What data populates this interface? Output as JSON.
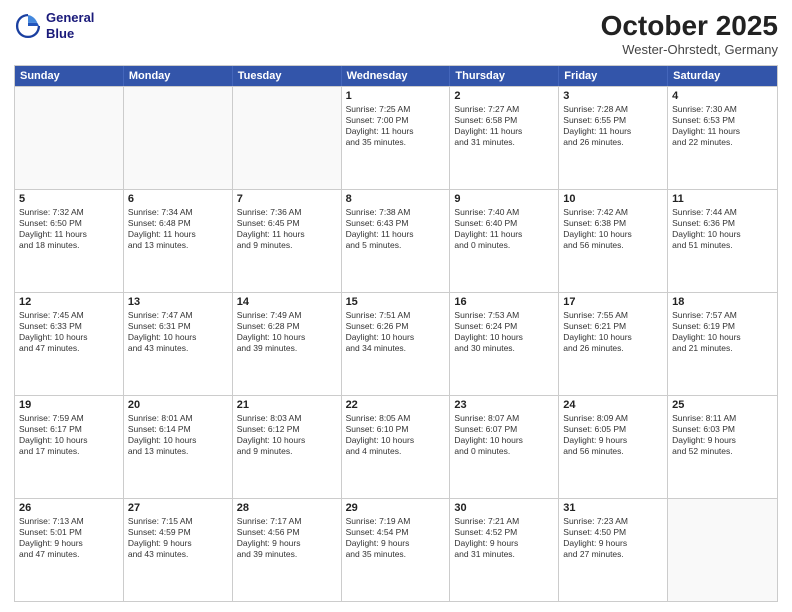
{
  "header": {
    "logo_line1": "General",
    "logo_line2": "Blue",
    "month": "October 2025",
    "location": "Wester-Ohrstedt, Germany"
  },
  "days_of_week": [
    "Sunday",
    "Monday",
    "Tuesday",
    "Wednesday",
    "Thursday",
    "Friday",
    "Saturday"
  ],
  "rows": [
    [
      {
        "num": "",
        "lines": [],
        "empty": true
      },
      {
        "num": "",
        "lines": [],
        "empty": true
      },
      {
        "num": "",
        "lines": [],
        "empty": true
      },
      {
        "num": "1",
        "lines": [
          "Sunrise: 7:25 AM",
          "Sunset: 7:00 PM",
          "Daylight: 11 hours",
          "and 35 minutes."
        ]
      },
      {
        "num": "2",
        "lines": [
          "Sunrise: 7:27 AM",
          "Sunset: 6:58 PM",
          "Daylight: 11 hours",
          "and 31 minutes."
        ]
      },
      {
        "num": "3",
        "lines": [
          "Sunrise: 7:28 AM",
          "Sunset: 6:55 PM",
          "Daylight: 11 hours",
          "and 26 minutes."
        ]
      },
      {
        "num": "4",
        "lines": [
          "Sunrise: 7:30 AM",
          "Sunset: 6:53 PM",
          "Daylight: 11 hours",
          "and 22 minutes."
        ]
      }
    ],
    [
      {
        "num": "5",
        "lines": [
          "Sunrise: 7:32 AM",
          "Sunset: 6:50 PM",
          "Daylight: 11 hours",
          "and 18 minutes."
        ]
      },
      {
        "num": "6",
        "lines": [
          "Sunrise: 7:34 AM",
          "Sunset: 6:48 PM",
          "Daylight: 11 hours",
          "and 13 minutes."
        ]
      },
      {
        "num": "7",
        "lines": [
          "Sunrise: 7:36 AM",
          "Sunset: 6:45 PM",
          "Daylight: 11 hours",
          "and 9 minutes."
        ]
      },
      {
        "num": "8",
        "lines": [
          "Sunrise: 7:38 AM",
          "Sunset: 6:43 PM",
          "Daylight: 11 hours",
          "and 5 minutes."
        ]
      },
      {
        "num": "9",
        "lines": [
          "Sunrise: 7:40 AM",
          "Sunset: 6:40 PM",
          "Daylight: 11 hours",
          "and 0 minutes."
        ]
      },
      {
        "num": "10",
        "lines": [
          "Sunrise: 7:42 AM",
          "Sunset: 6:38 PM",
          "Daylight: 10 hours",
          "and 56 minutes."
        ]
      },
      {
        "num": "11",
        "lines": [
          "Sunrise: 7:44 AM",
          "Sunset: 6:36 PM",
          "Daylight: 10 hours",
          "and 51 minutes."
        ]
      }
    ],
    [
      {
        "num": "12",
        "lines": [
          "Sunrise: 7:45 AM",
          "Sunset: 6:33 PM",
          "Daylight: 10 hours",
          "and 47 minutes."
        ]
      },
      {
        "num": "13",
        "lines": [
          "Sunrise: 7:47 AM",
          "Sunset: 6:31 PM",
          "Daylight: 10 hours",
          "and 43 minutes."
        ]
      },
      {
        "num": "14",
        "lines": [
          "Sunrise: 7:49 AM",
          "Sunset: 6:28 PM",
          "Daylight: 10 hours",
          "and 39 minutes."
        ]
      },
      {
        "num": "15",
        "lines": [
          "Sunrise: 7:51 AM",
          "Sunset: 6:26 PM",
          "Daylight: 10 hours",
          "and 34 minutes."
        ]
      },
      {
        "num": "16",
        "lines": [
          "Sunrise: 7:53 AM",
          "Sunset: 6:24 PM",
          "Daylight: 10 hours",
          "and 30 minutes."
        ]
      },
      {
        "num": "17",
        "lines": [
          "Sunrise: 7:55 AM",
          "Sunset: 6:21 PM",
          "Daylight: 10 hours",
          "and 26 minutes."
        ]
      },
      {
        "num": "18",
        "lines": [
          "Sunrise: 7:57 AM",
          "Sunset: 6:19 PM",
          "Daylight: 10 hours",
          "and 21 minutes."
        ]
      }
    ],
    [
      {
        "num": "19",
        "lines": [
          "Sunrise: 7:59 AM",
          "Sunset: 6:17 PM",
          "Daylight: 10 hours",
          "and 17 minutes."
        ]
      },
      {
        "num": "20",
        "lines": [
          "Sunrise: 8:01 AM",
          "Sunset: 6:14 PM",
          "Daylight: 10 hours",
          "and 13 minutes."
        ]
      },
      {
        "num": "21",
        "lines": [
          "Sunrise: 8:03 AM",
          "Sunset: 6:12 PM",
          "Daylight: 10 hours",
          "and 9 minutes."
        ]
      },
      {
        "num": "22",
        "lines": [
          "Sunrise: 8:05 AM",
          "Sunset: 6:10 PM",
          "Daylight: 10 hours",
          "and 4 minutes."
        ]
      },
      {
        "num": "23",
        "lines": [
          "Sunrise: 8:07 AM",
          "Sunset: 6:07 PM",
          "Daylight: 10 hours",
          "and 0 minutes."
        ]
      },
      {
        "num": "24",
        "lines": [
          "Sunrise: 8:09 AM",
          "Sunset: 6:05 PM",
          "Daylight: 9 hours",
          "and 56 minutes."
        ]
      },
      {
        "num": "25",
        "lines": [
          "Sunrise: 8:11 AM",
          "Sunset: 6:03 PM",
          "Daylight: 9 hours",
          "and 52 minutes."
        ]
      }
    ],
    [
      {
        "num": "26",
        "lines": [
          "Sunrise: 7:13 AM",
          "Sunset: 5:01 PM",
          "Daylight: 9 hours",
          "and 47 minutes."
        ]
      },
      {
        "num": "27",
        "lines": [
          "Sunrise: 7:15 AM",
          "Sunset: 4:59 PM",
          "Daylight: 9 hours",
          "and 43 minutes."
        ]
      },
      {
        "num": "28",
        "lines": [
          "Sunrise: 7:17 AM",
          "Sunset: 4:56 PM",
          "Daylight: 9 hours",
          "and 39 minutes."
        ]
      },
      {
        "num": "29",
        "lines": [
          "Sunrise: 7:19 AM",
          "Sunset: 4:54 PM",
          "Daylight: 9 hours",
          "and 35 minutes."
        ]
      },
      {
        "num": "30",
        "lines": [
          "Sunrise: 7:21 AM",
          "Sunset: 4:52 PM",
          "Daylight: 9 hours",
          "and 31 minutes."
        ]
      },
      {
        "num": "31",
        "lines": [
          "Sunrise: 7:23 AM",
          "Sunset: 4:50 PM",
          "Daylight: 9 hours",
          "and 27 minutes."
        ]
      },
      {
        "num": "",
        "lines": [],
        "empty": true
      }
    ]
  ]
}
